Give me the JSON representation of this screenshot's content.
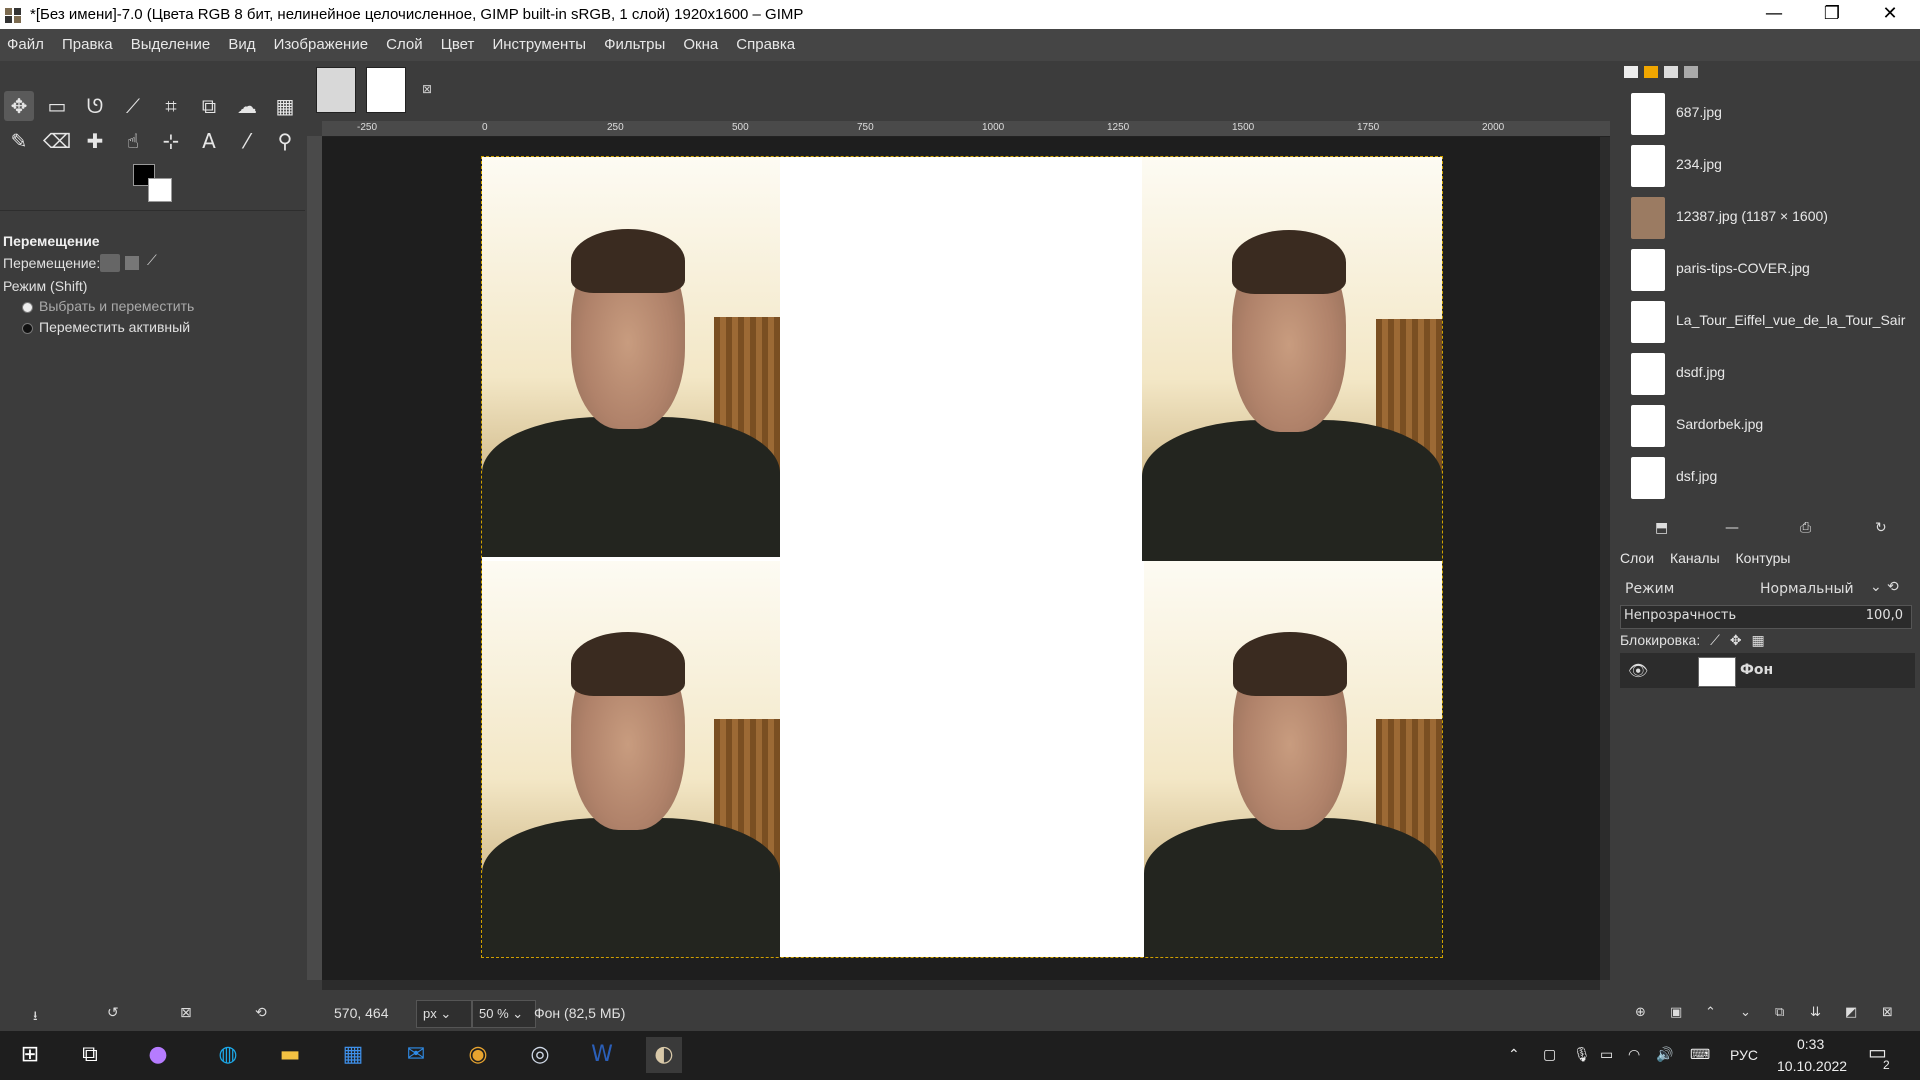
{
  "titlebar": {
    "title": "*[Без имени]-7.0 (Цвета RGB 8 бит, нелинейное целочисленное, GIMP built-in sRGB, 1 слой) 1920x1600 – GIMP",
    "minimize": "—",
    "restore": "❐",
    "close": "✕"
  },
  "menu": [
    "Файл",
    "Правка",
    "Выделение",
    "Вид",
    "Изображение",
    "Слой",
    "Цвет",
    "Инструменты",
    "Фильтры",
    "Окна",
    "Справка"
  ],
  "toolbox": {
    "tools": [
      {
        "name": "move-tool-icon",
        "glyph": "✥"
      },
      {
        "name": "rect-select-tool-icon",
        "glyph": "▭"
      },
      {
        "name": "lasso-tool-icon",
        "glyph": "ᘎ"
      },
      {
        "name": "fuzzy-select-tool-icon",
        "glyph": "⟋"
      },
      {
        "name": "crop-tool-icon",
        "glyph": "⌗"
      },
      {
        "name": "transform-tool-icon",
        "glyph": "⧉"
      },
      {
        "name": "warp-tool-icon",
        "glyph": "☁"
      },
      {
        "name": "gradient-tool-icon",
        "glyph": "▦"
      },
      {
        "name": "pencil-tool-icon",
        "glyph": "✎"
      },
      {
        "name": "eraser-tool-icon",
        "glyph": "⌫"
      },
      {
        "name": "heal-tool-icon",
        "glyph": "✚"
      },
      {
        "name": "smudge-tool-icon",
        "glyph": "☝"
      },
      {
        "name": "paths-tool-icon",
        "glyph": "⊹"
      },
      {
        "name": "text-tool-icon",
        "glyph": "A"
      },
      {
        "name": "color-picker-tool-icon",
        "glyph": "⁄"
      },
      {
        "name": "zoom-tool-icon",
        "glyph": "⚲"
      }
    ],
    "options": {
      "title": "Перемещение",
      "move_label": "Перемещение:",
      "mode_label": "Режим (Shift)",
      "radio_pick": "Выбрать и переместить",
      "radio_active": "Переместить активный"
    }
  },
  "rulers": {
    "h_ticks": [
      "-250",
      "0",
      "250",
      "500",
      "750",
      "1000",
      "1250",
      "1500",
      "1750",
      "2000"
    ]
  },
  "status": {
    "coords": "570, 464",
    "unit": "px",
    "zoom": "50 %",
    "layer_info": "Фон (82,5 МБ)"
  },
  "documents": [
    {
      "label": "687.jpg",
      "thumb": "blank"
    },
    {
      "label": "234.jpg",
      "thumb": "blank"
    },
    {
      "label": "12387.jpg (1187 × 1600)",
      "thumb": "photo"
    },
    {
      "label": "paris-tips-COVER.jpg",
      "thumb": "blank"
    },
    {
      "label": "La_Tour_Eiffel_vue_de_la_Tour_Sair",
      "thumb": "blank"
    },
    {
      "label": "dsdf.jpg",
      "thumb": "blank"
    },
    {
      "label": "Sardorbek.jpg",
      "thumb": "blank"
    },
    {
      "label": "dsf.jpg",
      "thumb": "blank"
    }
  ],
  "layers_panel": {
    "tab_layers": "Слои",
    "tab_channels": "Каналы",
    "tab_paths": "Контуры",
    "mode_label": "Режим",
    "mode_value": "Нормальный",
    "opacity_label": "Непрозрачность",
    "opacity_value": "100,0",
    "lock_label": "Блокировка:",
    "layer_name": "Фон"
  },
  "taskbar": {
    "lang": "РУС",
    "time": "0:33",
    "date": "10.10.2022",
    "notifications": "2"
  },
  "colors": {
    "accent_selection": "#cfa100",
    "panel_bg": "#3c3c3c",
    "canvas_bg": "#1e1e1e"
  }
}
